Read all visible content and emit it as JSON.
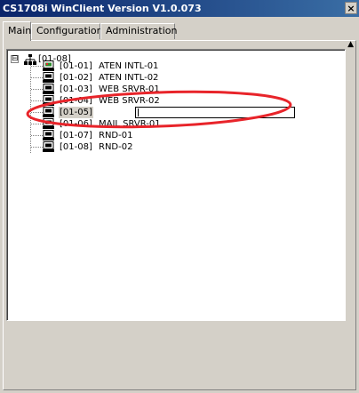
{
  "window": {
    "title": "CS1708i WinClient Version V1.0.073",
    "close_glyph": "×"
  },
  "tabs": [
    {
      "label": "Main",
      "active": true
    },
    {
      "label": "Configuration",
      "active": false
    },
    {
      "label": "Administration",
      "active": false
    }
  ],
  "tree": {
    "root": {
      "label": "[01-08]",
      "icon": "network-tree-icon",
      "expander": "⊟"
    },
    "items": [
      {
        "port": "[01-01]",
        "name": "ATEN INTL-01",
        "icon": "computer-active-icon"
      },
      {
        "port": "[01-02]",
        "name": "ATEN INTL-02",
        "icon": "computer-icon"
      },
      {
        "port": "[01-03]",
        "name": "WEB SRVR-01",
        "icon": "computer-icon"
      },
      {
        "port": "[01-04]",
        "name": "WEB SRVR-02",
        "icon": "computer-icon"
      },
      {
        "port": "[01-05]",
        "name": "",
        "icon": "computer-icon",
        "editing": true
      },
      {
        "port": "[01-06]",
        "name": "MAIL SRVR-01",
        "icon": "computer-icon"
      },
      {
        "port": "[01-07]",
        "name": "RND-01",
        "icon": "computer-icon"
      },
      {
        "port": "[01-08]",
        "name": "RND-02",
        "icon": "computer-icon"
      }
    ]
  },
  "scroll_up_glyph": "▲",
  "colors": {
    "titlebar": "#0a246a",
    "annotation": "#e8242a",
    "active_port": "#2e8b2e"
  }
}
